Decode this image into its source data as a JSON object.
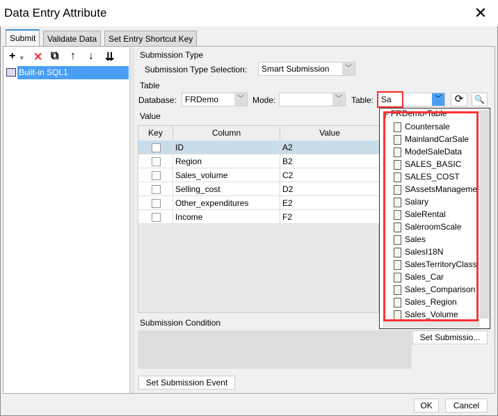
{
  "window": {
    "title": "Data Entry Attribute",
    "close": "✕"
  },
  "tabs": [
    "Submit",
    "Validate Data",
    "Set Entry Shortcut Key"
  ],
  "left": {
    "toolbar": [
      "+",
      "▾",
      "✕",
      "⧉",
      "↑",
      "↓",
      "⇊"
    ],
    "items": [
      "Built-in SQL1"
    ]
  },
  "submission_type": {
    "section": "Submission Type",
    "label": "Submission Type Selection:",
    "value": "Smart Submission"
  },
  "table": {
    "section": "Table",
    "db_label": "Database:",
    "db_value": "FRDemo",
    "mode_label": "Mode:",
    "mode_value": "",
    "table_label": "Table:",
    "table_value": "Sa"
  },
  "value": {
    "section": "Value",
    "headers": [
      "Key",
      "Column",
      "Value"
    ],
    "rows": [
      {
        "column": "ID",
        "value": "A2"
      },
      {
        "column": "Region",
        "value": "B2"
      },
      {
        "column": "Sales_volume",
        "value": "C2"
      },
      {
        "column": "Selling_cost",
        "value": "D2"
      },
      {
        "column": "Other_expenditures",
        "value": "E2"
      },
      {
        "column": "Income",
        "value": "F2"
      }
    ]
  },
  "dropdown": {
    "root": "FRDemo-Table",
    "items": [
      "Countersale",
      "MainlandCarSale",
      "ModelSaleData",
      "SALES_BASIC",
      "SALES_COST",
      "SAssetsManagement",
      "Salary",
      "SaleRental",
      "SaleroomScale",
      "Sales",
      "SalesI18N",
      "SalesTerritoryClass",
      "Sales_Car",
      "Sales_Comparison",
      "Sales_Region",
      "Sales_Volume"
    ]
  },
  "condition": {
    "section": "Submission Condition",
    "button": "Set Submissio..."
  },
  "event_button": "Set Submission Event",
  "footer": {
    "ok": "OK",
    "cancel": "Cancel"
  },
  "colors": {
    "highlight": "#ff3333",
    "selection": "#4a9ff5"
  }
}
